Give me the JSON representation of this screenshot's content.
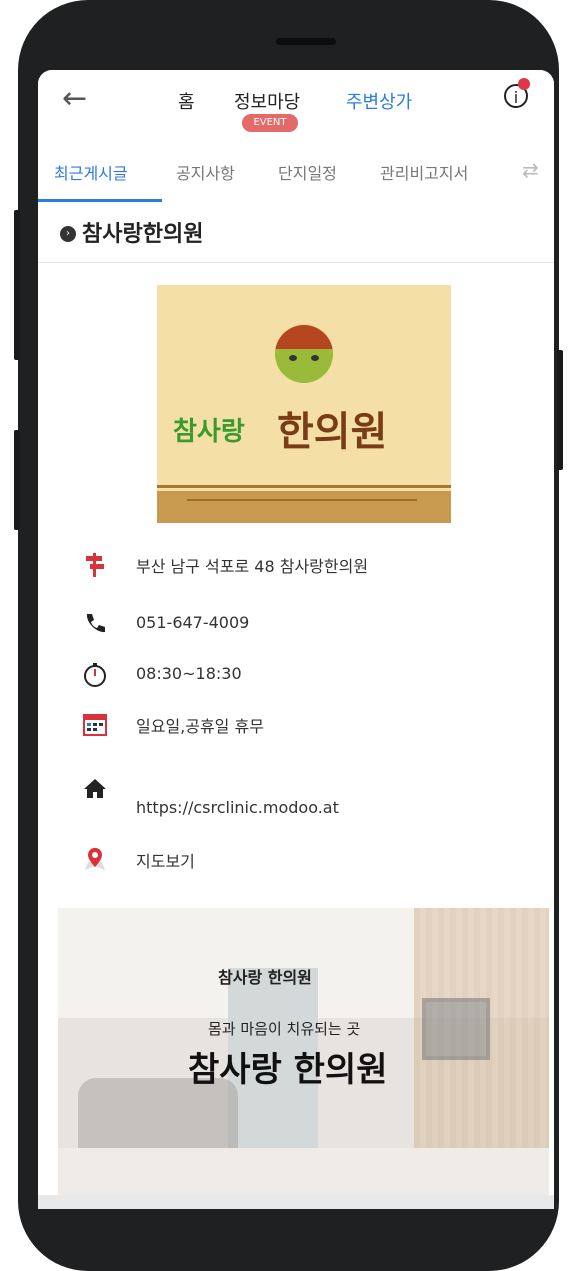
{
  "header": {
    "nav": [
      "홈",
      "정보마당",
      "주변상가"
    ],
    "event_badge": "EVENT"
  },
  "tabs": [
    "최근게시글",
    "공지사항",
    "단지일정",
    "관리비고지서"
  ],
  "page_title": "참사랑한의원",
  "logo": {
    "text_green": "참사랑",
    "text_brown": "한의원"
  },
  "info": {
    "address": "부산 남구 석포로 48 참사랑한의원",
    "phone": "051-647-4009",
    "hours": "08:30~18:30",
    "closed": "일요일,공휴일 휴무",
    "website": "https://csrclinic.modoo.at",
    "map": "지도보기"
  },
  "banner": {
    "logo": "참사랑 한의원",
    "subtitle": "몸과 마음이 치유되는 곳",
    "title": "참사랑 한의원"
  },
  "colors": {
    "accent": "#2c7be0",
    "event": "#e46a6a",
    "logo_bg": "#f4e0a7"
  }
}
